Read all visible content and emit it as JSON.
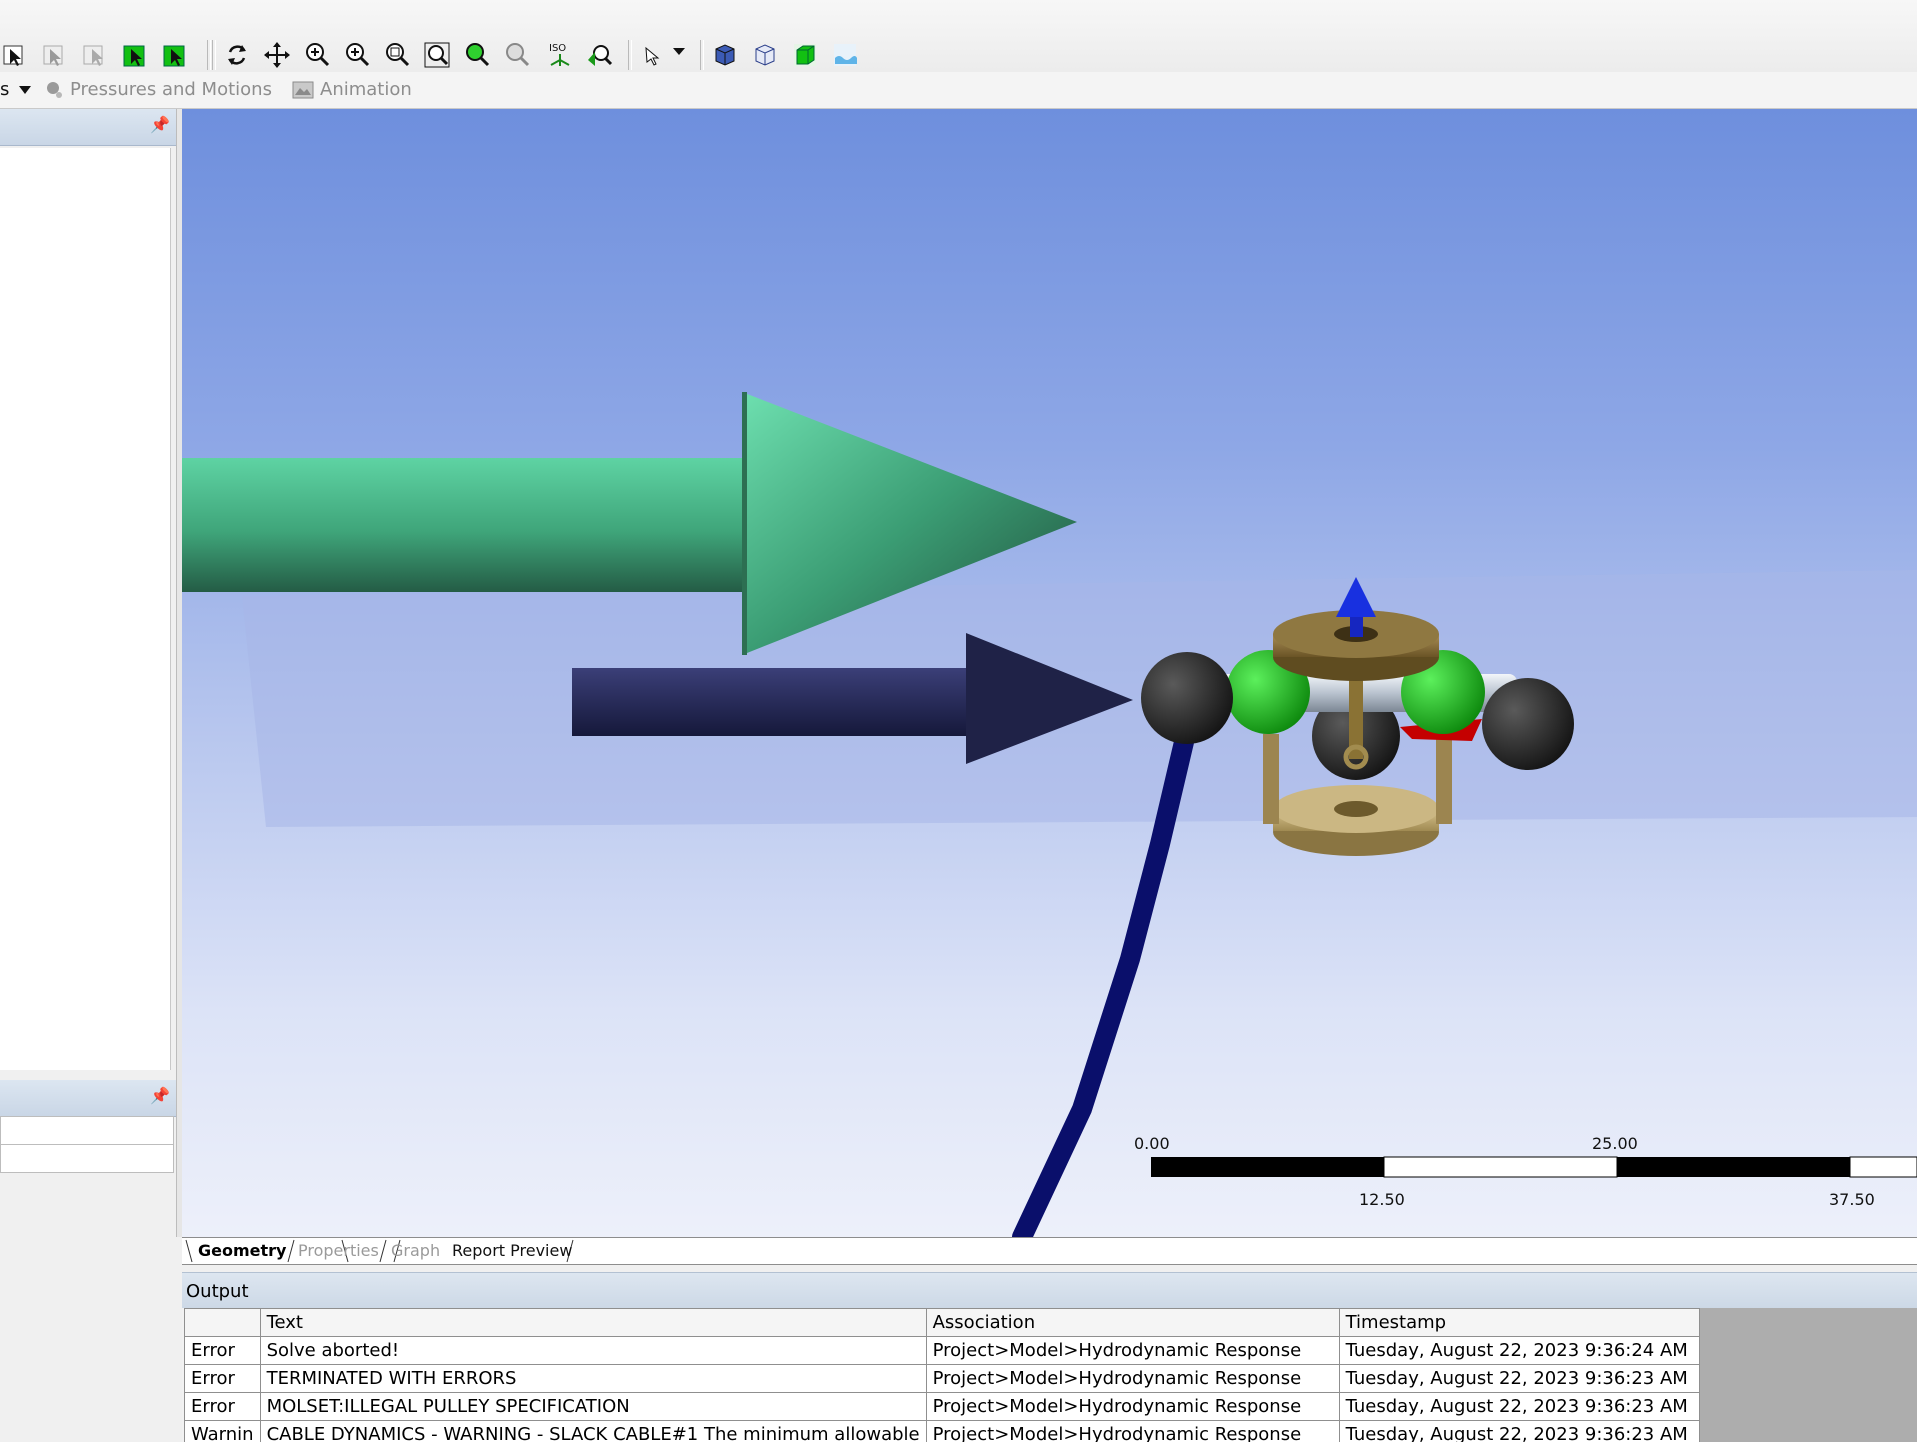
{
  "toolbar": {
    "icons": [
      "select-cursor-icon",
      "select-body-icon",
      "select-vertex-icon",
      "select-green-edge-icon",
      "select-green-face-icon",
      "rotate-icon",
      "pan-icon",
      "zoom-in-icon",
      "zoom-plus-icon",
      "zoom-box-icon",
      "zoom-fit-icon",
      "zoom-green-icon",
      "zoom-out-icon",
      "iso-view-icon",
      "previous-view-icon",
      "pointer-mode-icon",
      "shaded-view-icon",
      "wireframe-view-icon",
      "green-cube-icon",
      "water-surface-icon"
    ]
  },
  "context_bar": {
    "truncated_item": "s",
    "pressures": "Pressures and Motions",
    "animation": "Animation"
  },
  "scale_bar": {
    "labels_top": [
      "0.00",
      "25.00"
    ],
    "labels_bottom": [
      "12.50",
      "37.50"
    ]
  },
  "tabs": [
    "Geometry",
    "Properties",
    "Graph",
    "Report Preview"
  ],
  "output": {
    "title": "Output",
    "columns": [
      "",
      "Text",
      "Association",
      "Timestamp"
    ],
    "rows": [
      [
        "Error",
        "Solve aborted!",
        "Project>Model>Hydrodynamic Response",
        "Tuesday, August 22, 2023 9:36:24 AM"
      ],
      [
        "Error",
        "TERMINATED WITH ERRORS",
        "Project>Model>Hydrodynamic Response",
        "Tuesday, August 22, 2023 9:36:23 AM"
      ],
      [
        "Error",
        "MOLSET:ILLEGAL PULLEY SPECIFICATION",
        "Project>Model>Hydrodynamic Response",
        "Tuesday, August 22, 2023 9:36:23 AM"
      ],
      [
        "Warnin",
        "CABLE DYNAMICS - WARNING - SLACK CABLE#1 The minimum allowable",
        "Project>Model>Hydrodynamic Response",
        "Tuesday, August 22, 2023 9:36:23 AM"
      ]
    ]
  },
  "colors": {
    "wind_arrow": "#4ec594",
    "current_arrow": "#262a57",
    "mooring_line": "#0a0f6b",
    "buoy_green": "#1fb51f",
    "float_dark": "#2a2a2a",
    "platform_brass": "#8c7440",
    "axis_arrow": "#1020c8"
  }
}
